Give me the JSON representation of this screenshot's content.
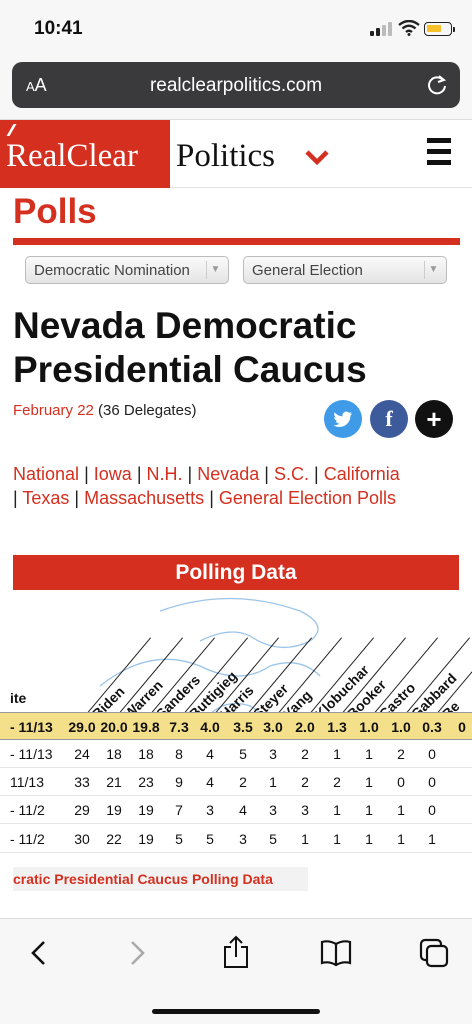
{
  "status_bar": {
    "time": "10:41"
  },
  "browser": {
    "aa_label_small": "A",
    "aa_label_large": "A",
    "url": "realclearpolitics.com"
  },
  "site": {
    "logo_left": "RealClear",
    "logo_right": "Politics",
    "section": "Polls"
  },
  "selects": [
    {
      "value": "Democratic Nomination"
    },
    {
      "value": "General Election"
    }
  ],
  "page": {
    "title": "Nevada Democratic Presidential Caucus",
    "date": "February 22",
    "delegates": "(36 Delegates)"
  },
  "share": {
    "twitter": "twitter-icon",
    "facebook": "f",
    "plus": "+"
  },
  "state_links": {
    "national": "National",
    "iowa": "Iowa",
    "nh": "N.H.",
    "nevada": "Nevada",
    "sc": "S.C.",
    "california": "California",
    "texas": "Texas",
    "massachusetts": "Massachusetts",
    "general": "General Election Polls",
    "sep": "|"
  },
  "polling_data_title": "Polling Data",
  "table": {
    "date_header": "ite",
    "columns": [
      "Biden",
      "Warren",
      "Sanders",
      "Buttigieg",
      "Harris",
      "Steyer",
      "Yang",
      "Klobuchar",
      "Booker",
      "Castro",
      "Gabbard",
      "Be"
    ],
    "rows": [
      {
        "date": "- 11/13",
        "values": [
          "29.0",
          "20.0",
          "19.8",
          "7.3",
          "4.0",
          "3.5",
          "3.0",
          "2.0",
          "1.3",
          "1.0",
          "1.0",
          "0.3",
          "0"
        ]
      },
      {
        "date": "- 11/13",
        "values": [
          "24",
          "18",
          "18",
          "8",
          "4",
          "5",
          "3",
          "2",
          "1",
          "1",
          "2",
          "0",
          ""
        ]
      },
      {
        "date": "11/13",
        "values": [
          "33",
          "21",
          "23",
          "9",
          "4",
          "2",
          "1",
          "2",
          "2",
          "1",
          "0",
          "0",
          ""
        ]
      },
      {
        "date": "- 11/2",
        "values": [
          "29",
          "19",
          "19",
          "7",
          "3",
          "4",
          "3",
          "3",
          "1",
          "1",
          "1",
          "0",
          ""
        ]
      },
      {
        "date": "- 11/2",
        "values": [
          "30",
          "22",
          "19",
          "5",
          "5",
          "3",
          "5",
          "1",
          "1",
          "1",
          "1",
          "1",
          ""
        ]
      }
    ],
    "footer_link": "cratic Presidential Caucus Polling Data"
  },
  "colors": {
    "brand_red": "#d42f1f",
    "average_row": "#f4e08a",
    "link_red": "#d42f1f"
  }
}
